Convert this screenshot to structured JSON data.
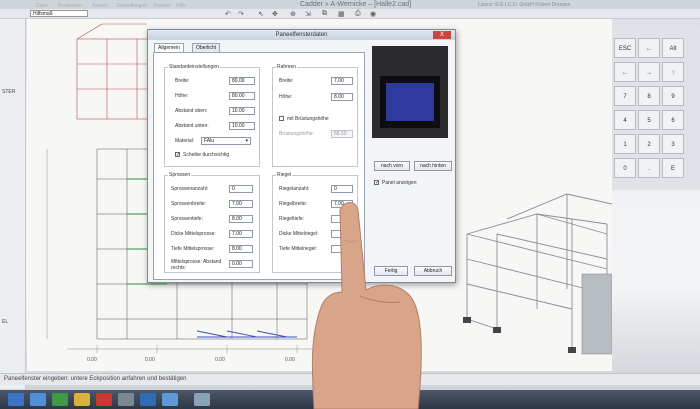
{
  "window": {
    "title": "Cadder » A-Wernicke – [Halle2.cad]",
    "company": "Lizenz: R.E.I.C.O. GmbH Robert Dresden",
    "menu": [
      "Datei",
      "Bearbeiten",
      "Ansicht",
      "Einstellungen",
      "Fenster",
      "Hilfe"
    ],
    "layer_combo": "Hilfsmaß"
  },
  "left_panel": {
    "items": [
      "STER",
      "",
      "EL"
    ]
  },
  "statusbar": {
    "text": "Paneelfenster eingeben: untere Eckposition anfahren und bestätigen"
  },
  "dialog": {
    "title": "Paneelfensterdaten",
    "close": "X",
    "tabs": [
      "Allgemein",
      "Oberlicht"
    ],
    "standard": {
      "title": "Standardeinstellungen",
      "breite_label": "Breite:",
      "breite": "80.00",
      "hoehe_label": "Höhe:",
      "hoehe": "80.00",
      "abstand_oben_label": "Abstand oben:",
      "abstand_oben": "10.00",
      "abstand_unten_label": "Abstand unten:",
      "abstand_unten": "10.00",
      "material_label": "Material:",
      "material": "FAlu",
      "scheibe_label": "Scheibe durchsichtig"
    },
    "rahmen": {
      "title": "Rahmen",
      "breite_label": "Breite:",
      "breite": "7.00",
      "hoehe_label": "Höhe:",
      "hoehe": "8.00",
      "brustung_label": "mit Brüstungshöhe",
      "brustung_hoehe_label": "Brüstungshöhe:",
      "brustung_hoehe": "68.50"
    },
    "sprossen": {
      "title": "Sprossen",
      "anzahl_label": "Sprossenanzahl:",
      "anzahl": "0",
      "breite_label": "Sprossenbreite:",
      "breite": "7.00",
      "tiefe_label": "Sprossentiefe:",
      "tiefe": "8.00",
      "dicke_label": "Dicke Mittelsprosse:",
      "dicke": "7.00",
      "tiefe_mittel_label": "Tiefe Mittelsprosse:",
      "tiefe_mittel": "8.00",
      "abstand_label": "Mittelsprosse: Abstand rechts:",
      "abstand": "0.00"
    },
    "riegel": {
      "title": "Riegel",
      "anzahl_label": "Riegelanzahl:",
      "anzahl": "0",
      "breite_label": "Riegelbreite:",
      "breite": "7.00",
      "tiefe_label": "Riegeltiefe:",
      "dicke_label": "Dicke Mittelriegel:",
      "tiefe_mittel_label": "Tiefe Mittelriegel:"
    },
    "nach_vorn": "nach vorn",
    "nach_hinten": "nach hinten",
    "panel_anzeigen": "Panel anzeigen",
    "ok": "Fertig",
    "cancel": "Abbruch"
  },
  "numpad": {
    "keys": [
      "ESC",
      "←",
      "Alt",
      "←",
      "→",
      "↑",
      "↓",
      "7",
      "8",
      "9",
      "4",
      "5",
      "6",
      "1",
      "2",
      "3",
      "0",
      ".",
      "E"
    ]
  },
  "drawing": {
    "dims": [
      "0.00",
      "0.00",
      "0.00",
      "0.00"
    ]
  }
}
